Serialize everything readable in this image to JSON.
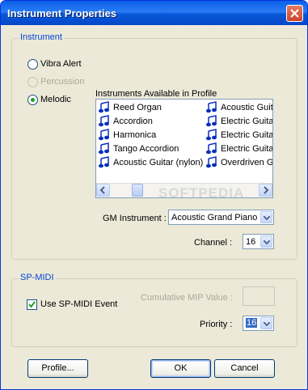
{
  "window": {
    "title": "Instrument Properties",
    "close_icon": "close-icon"
  },
  "instrument": {
    "group_label": "Instrument",
    "options": [
      {
        "label": "Vibra Alert",
        "selected": false,
        "enabled": true
      },
      {
        "label": "Percussion",
        "selected": false,
        "enabled": false
      },
      {
        "label": "Melodic",
        "selected": true,
        "enabled": true
      }
    ],
    "list_label": "Instruments Available in Profile",
    "list_col1": [
      "Reed Organ",
      "Accordion",
      "Harmonica",
      "Tango Accordion",
      "Acoustic Guitar (nylon)"
    ],
    "list_col2": [
      "Acoustic Guita",
      "Electric Guitar",
      "Electric Guitar",
      "Electric Guitar",
      "Overdriven Gu"
    ],
    "gm_label": "GM Instrument :",
    "gm_value": "Acoustic Grand Piano",
    "channel_label": "Channel :",
    "channel_value": "16"
  },
  "spmidi": {
    "group_label": "SP-MIDI",
    "use_event_label": "Use SP-MIDI Event",
    "use_event_checked": true,
    "mip_label": "Cumulative MIP Value :",
    "priority_label": "Priority :",
    "priority_value": "16"
  },
  "buttons": {
    "profile": "Profile...",
    "ok": "OK",
    "cancel": "Cancel"
  },
  "watermark": "SOFTPEDIA",
  "colors": {
    "titlebar": "#0a5fe6",
    "group_label": "#0046d5",
    "dialog_bg": "#ece9d8",
    "radio_dot": "#21a121"
  }
}
